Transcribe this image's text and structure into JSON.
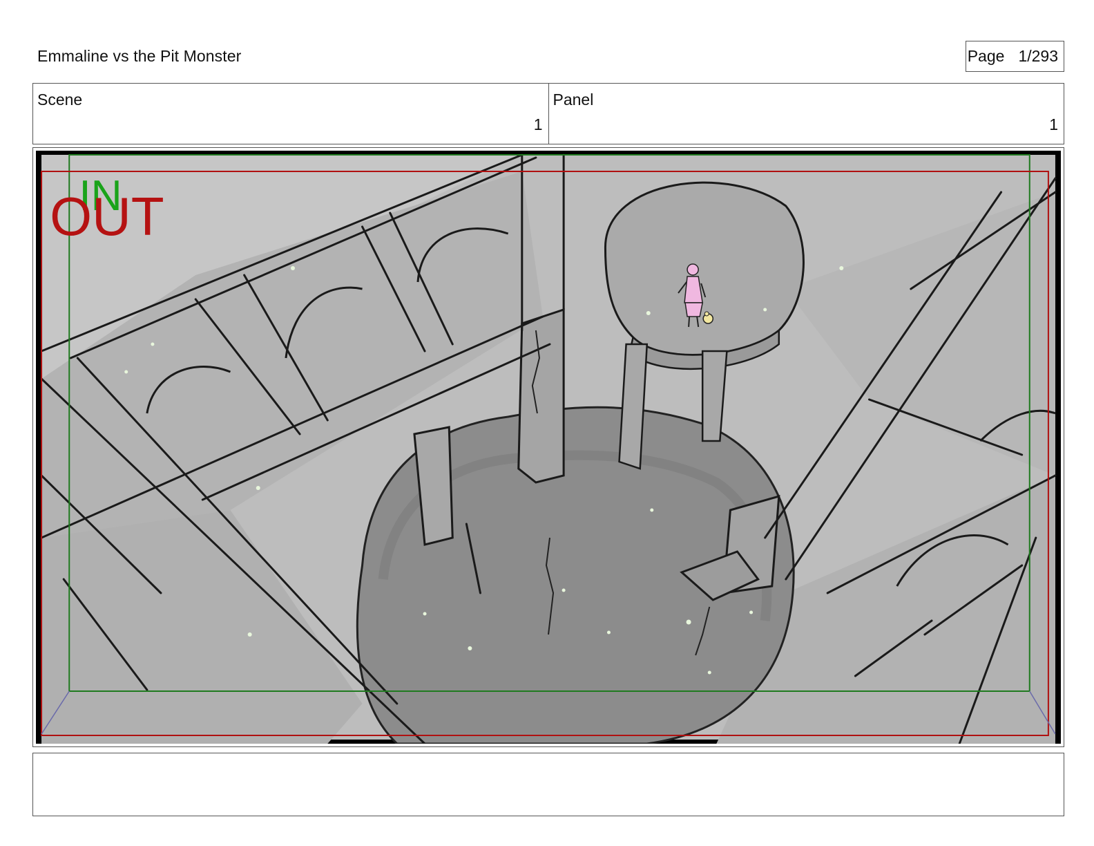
{
  "document": {
    "title": "Emmaline vs the Pit Monster",
    "page_label": "Page",
    "page_number": "1/293"
  },
  "scene": {
    "label": "Scene",
    "value": "1"
  },
  "panel": {
    "label": "Panel",
    "value": "1"
  },
  "frame_marks": {
    "in_label": "IN",
    "out_label": "OUT"
  },
  "colors": {
    "in_frame": "#1f7a1f",
    "out_frame": "#b01010",
    "in_text": "#1aa31a",
    "out_text": "#b51212",
    "character": "#f0b8e0"
  },
  "notes": {
    "text": ""
  }
}
